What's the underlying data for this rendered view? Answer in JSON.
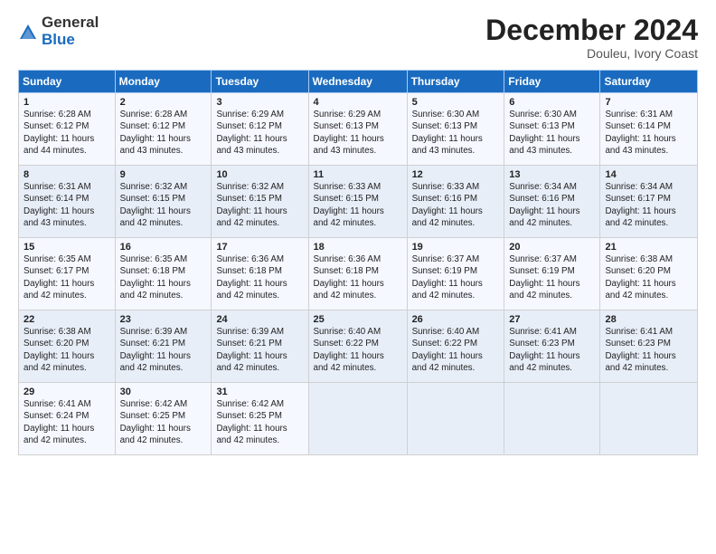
{
  "header": {
    "logo_general": "General",
    "logo_blue": "Blue",
    "month_title": "December 2024",
    "subtitle": "Douleu, Ivory Coast"
  },
  "days_of_week": [
    "Sunday",
    "Monday",
    "Tuesday",
    "Wednesday",
    "Thursday",
    "Friday",
    "Saturday"
  ],
  "weeks": [
    [
      {
        "day": "1",
        "info": "Sunrise: 6:28 AM\nSunset: 6:12 PM\nDaylight: 11 hours\nand 44 minutes."
      },
      {
        "day": "2",
        "info": "Sunrise: 6:28 AM\nSunset: 6:12 PM\nDaylight: 11 hours\nand 43 minutes."
      },
      {
        "day": "3",
        "info": "Sunrise: 6:29 AM\nSunset: 6:12 PM\nDaylight: 11 hours\nand 43 minutes."
      },
      {
        "day": "4",
        "info": "Sunrise: 6:29 AM\nSunset: 6:13 PM\nDaylight: 11 hours\nand 43 minutes."
      },
      {
        "day": "5",
        "info": "Sunrise: 6:30 AM\nSunset: 6:13 PM\nDaylight: 11 hours\nand 43 minutes."
      },
      {
        "day": "6",
        "info": "Sunrise: 6:30 AM\nSunset: 6:13 PM\nDaylight: 11 hours\nand 43 minutes."
      },
      {
        "day": "7",
        "info": "Sunrise: 6:31 AM\nSunset: 6:14 PM\nDaylight: 11 hours\nand 43 minutes."
      }
    ],
    [
      {
        "day": "8",
        "info": "Sunrise: 6:31 AM\nSunset: 6:14 PM\nDaylight: 11 hours\nand 43 minutes."
      },
      {
        "day": "9",
        "info": "Sunrise: 6:32 AM\nSunset: 6:15 PM\nDaylight: 11 hours\nand 42 minutes."
      },
      {
        "day": "10",
        "info": "Sunrise: 6:32 AM\nSunset: 6:15 PM\nDaylight: 11 hours\nand 42 minutes."
      },
      {
        "day": "11",
        "info": "Sunrise: 6:33 AM\nSunset: 6:15 PM\nDaylight: 11 hours\nand 42 minutes."
      },
      {
        "day": "12",
        "info": "Sunrise: 6:33 AM\nSunset: 6:16 PM\nDaylight: 11 hours\nand 42 minutes."
      },
      {
        "day": "13",
        "info": "Sunrise: 6:34 AM\nSunset: 6:16 PM\nDaylight: 11 hours\nand 42 minutes."
      },
      {
        "day": "14",
        "info": "Sunrise: 6:34 AM\nSunset: 6:17 PM\nDaylight: 11 hours\nand 42 minutes."
      }
    ],
    [
      {
        "day": "15",
        "info": "Sunrise: 6:35 AM\nSunset: 6:17 PM\nDaylight: 11 hours\nand 42 minutes."
      },
      {
        "day": "16",
        "info": "Sunrise: 6:35 AM\nSunset: 6:18 PM\nDaylight: 11 hours\nand 42 minutes."
      },
      {
        "day": "17",
        "info": "Sunrise: 6:36 AM\nSunset: 6:18 PM\nDaylight: 11 hours\nand 42 minutes."
      },
      {
        "day": "18",
        "info": "Sunrise: 6:36 AM\nSunset: 6:18 PM\nDaylight: 11 hours\nand 42 minutes."
      },
      {
        "day": "19",
        "info": "Sunrise: 6:37 AM\nSunset: 6:19 PM\nDaylight: 11 hours\nand 42 minutes."
      },
      {
        "day": "20",
        "info": "Sunrise: 6:37 AM\nSunset: 6:19 PM\nDaylight: 11 hours\nand 42 minutes."
      },
      {
        "day": "21",
        "info": "Sunrise: 6:38 AM\nSunset: 6:20 PM\nDaylight: 11 hours\nand 42 minutes."
      }
    ],
    [
      {
        "day": "22",
        "info": "Sunrise: 6:38 AM\nSunset: 6:20 PM\nDaylight: 11 hours\nand 42 minutes."
      },
      {
        "day": "23",
        "info": "Sunrise: 6:39 AM\nSunset: 6:21 PM\nDaylight: 11 hours\nand 42 minutes."
      },
      {
        "day": "24",
        "info": "Sunrise: 6:39 AM\nSunset: 6:21 PM\nDaylight: 11 hours\nand 42 minutes."
      },
      {
        "day": "25",
        "info": "Sunrise: 6:40 AM\nSunset: 6:22 PM\nDaylight: 11 hours\nand 42 minutes."
      },
      {
        "day": "26",
        "info": "Sunrise: 6:40 AM\nSunset: 6:22 PM\nDaylight: 11 hours\nand 42 minutes."
      },
      {
        "day": "27",
        "info": "Sunrise: 6:41 AM\nSunset: 6:23 PM\nDaylight: 11 hours\nand 42 minutes."
      },
      {
        "day": "28",
        "info": "Sunrise: 6:41 AM\nSunset: 6:23 PM\nDaylight: 11 hours\nand 42 minutes."
      }
    ],
    [
      {
        "day": "29",
        "info": "Sunrise: 6:41 AM\nSunset: 6:24 PM\nDaylight: 11 hours\nand 42 minutes."
      },
      {
        "day": "30",
        "info": "Sunrise: 6:42 AM\nSunset: 6:25 PM\nDaylight: 11 hours\nand 42 minutes."
      },
      {
        "day": "31",
        "info": "Sunrise: 6:42 AM\nSunset: 6:25 PM\nDaylight: 11 hours\nand 42 minutes."
      },
      null,
      null,
      null,
      null
    ]
  ]
}
